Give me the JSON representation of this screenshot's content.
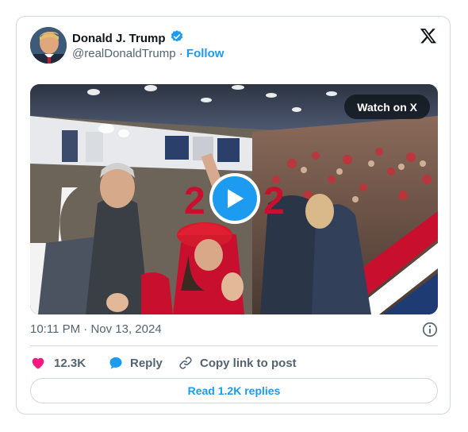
{
  "author": {
    "name": "Donald J. Trump",
    "handle": "@realDonaldTrump",
    "separator": "·",
    "follow_label": "Follow",
    "verified": true
  },
  "media": {
    "watch_label": "Watch on X",
    "overlay_text_left": "2",
    "overlay_text_right": "2"
  },
  "meta": {
    "time": "10:11 PM",
    "separator": "·",
    "date": "Nov 13, 2024"
  },
  "actions": {
    "likes": "12.3K",
    "reply_label": "Reply",
    "copy_label": "Copy link to post"
  },
  "read_replies_label": "Read 1.2K replies",
  "colors": {
    "accent": "#1d9bf0",
    "like": "#f91880",
    "text": "#0f1419",
    "muted": "#536471",
    "border": "#cfd9de"
  },
  "icons": [
    "verified-badge-icon",
    "x-logo-icon",
    "play-icon",
    "info-icon",
    "heart-icon",
    "reply-bubble-icon",
    "link-icon"
  ]
}
